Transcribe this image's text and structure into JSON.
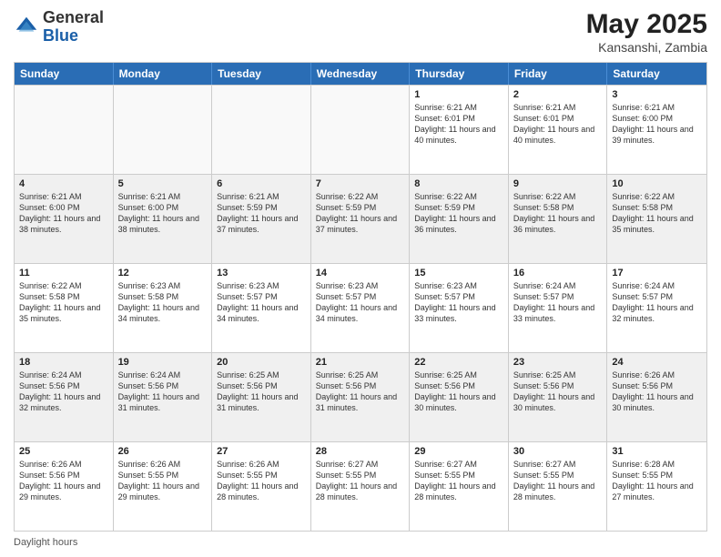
{
  "header": {
    "logo_general": "General",
    "logo_blue": "Blue",
    "title": "May 2025",
    "location": "Kansanshi, Zambia"
  },
  "days": [
    "Sunday",
    "Monday",
    "Tuesday",
    "Wednesday",
    "Thursday",
    "Friday",
    "Saturday"
  ],
  "footer": "Daylight hours",
  "weeks": [
    [
      {
        "date": "",
        "empty": true
      },
      {
        "date": "",
        "empty": true
      },
      {
        "date": "",
        "empty": true
      },
      {
        "date": "",
        "empty": true
      },
      {
        "date": "1",
        "sunrise": "6:21 AM",
        "sunset": "6:01 PM",
        "daylight": "11 hours and 40 minutes."
      },
      {
        "date": "2",
        "sunrise": "6:21 AM",
        "sunset": "6:01 PM",
        "daylight": "11 hours and 40 minutes."
      },
      {
        "date": "3",
        "sunrise": "6:21 AM",
        "sunset": "6:00 PM",
        "daylight": "11 hours and 39 minutes."
      }
    ],
    [
      {
        "date": "4",
        "sunrise": "6:21 AM",
        "sunset": "6:00 PM",
        "daylight": "11 hours and 38 minutes."
      },
      {
        "date": "5",
        "sunrise": "6:21 AM",
        "sunset": "6:00 PM",
        "daylight": "11 hours and 38 minutes."
      },
      {
        "date": "6",
        "sunrise": "6:21 AM",
        "sunset": "5:59 PM",
        "daylight": "11 hours and 37 minutes."
      },
      {
        "date": "7",
        "sunrise": "6:22 AM",
        "sunset": "5:59 PM",
        "daylight": "11 hours and 37 minutes."
      },
      {
        "date": "8",
        "sunrise": "6:22 AM",
        "sunset": "5:59 PM",
        "daylight": "11 hours and 36 minutes."
      },
      {
        "date": "9",
        "sunrise": "6:22 AM",
        "sunset": "5:58 PM",
        "daylight": "11 hours and 36 minutes."
      },
      {
        "date": "10",
        "sunrise": "6:22 AM",
        "sunset": "5:58 PM",
        "daylight": "11 hours and 35 minutes."
      }
    ],
    [
      {
        "date": "11",
        "sunrise": "6:22 AM",
        "sunset": "5:58 PM",
        "daylight": "11 hours and 35 minutes."
      },
      {
        "date": "12",
        "sunrise": "6:23 AM",
        "sunset": "5:58 PM",
        "daylight": "11 hours and 34 minutes."
      },
      {
        "date": "13",
        "sunrise": "6:23 AM",
        "sunset": "5:57 PM",
        "daylight": "11 hours and 34 minutes."
      },
      {
        "date": "14",
        "sunrise": "6:23 AM",
        "sunset": "5:57 PM",
        "daylight": "11 hours and 34 minutes."
      },
      {
        "date": "15",
        "sunrise": "6:23 AM",
        "sunset": "5:57 PM",
        "daylight": "11 hours and 33 minutes."
      },
      {
        "date": "16",
        "sunrise": "6:24 AM",
        "sunset": "5:57 PM",
        "daylight": "11 hours and 33 minutes."
      },
      {
        "date": "17",
        "sunrise": "6:24 AM",
        "sunset": "5:57 PM",
        "daylight": "11 hours and 32 minutes."
      }
    ],
    [
      {
        "date": "18",
        "sunrise": "6:24 AM",
        "sunset": "5:56 PM",
        "daylight": "11 hours and 32 minutes."
      },
      {
        "date": "19",
        "sunrise": "6:24 AM",
        "sunset": "5:56 PM",
        "daylight": "11 hours and 31 minutes."
      },
      {
        "date": "20",
        "sunrise": "6:25 AM",
        "sunset": "5:56 PM",
        "daylight": "11 hours and 31 minutes."
      },
      {
        "date": "21",
        "sunrise": "6:25 AM",
        "sunset": "5:56 PM",
        "daylight": "11 hours and 31 minutes."
      },
      {
        "date": "22",
        "sunrise": "6:25 AM",
        "sunset": "5:56 PM",
        "daylight": "11 hours and 30 minutes."
      },
      {
        "date": "23",
        "sunrise": "6:25 AM",
        "sunset": "5:56 PM",
        "daylight": "11 hours and 30 minutes."
      },
      {
        "date": "24",
        "sunrise": "6:26 AM",
        "sunset": "5:56 PM",
        "daylight": "11 hours and 30 minutes."
      }
    ],
    [
      {
        "date": "25",
        "sunrise": "6:26 AM",
        "sunset": "5:56 PM",
        "daylight": "11 hours and 29 minutes."
      },
      {
        "date": "26",
        "sunrise": "6:26 AM",
        "sunset": "5:55 PM",
        "daylight": "11 hours and 29 minutes."
      },
      {
        "date": "27",
        "sunrise": "6:26 AM",
        "sunset": "5:55 PM",
        "daylight": "11 hours and 28 minutes."
      },
      {
        "date": "28",
        "sunrise": "6:27 AM",
        "sunset": "5:55 PM",
        "daylight": "11 hours and 28 minutes."
      },
      {
        "date": "29",
        "sunrise": "6:27 AM",
        "sunset": "5:55 PM",
        "daylight": "11 hours and 28 minutes."
      },
      {
        "date": "30",
        "sunrise": "6:27 AM",
        "sunset": "5:55 PM",
        "daylight": "11 hours and 28 minutes."
      },
      {
        "date": "31",
        "sunrise": "6:28 AM",
        "sunset": "5:55 PM",
        "daylight": "11 hours and 27 minutes."
      }
    ]
  ]
}
